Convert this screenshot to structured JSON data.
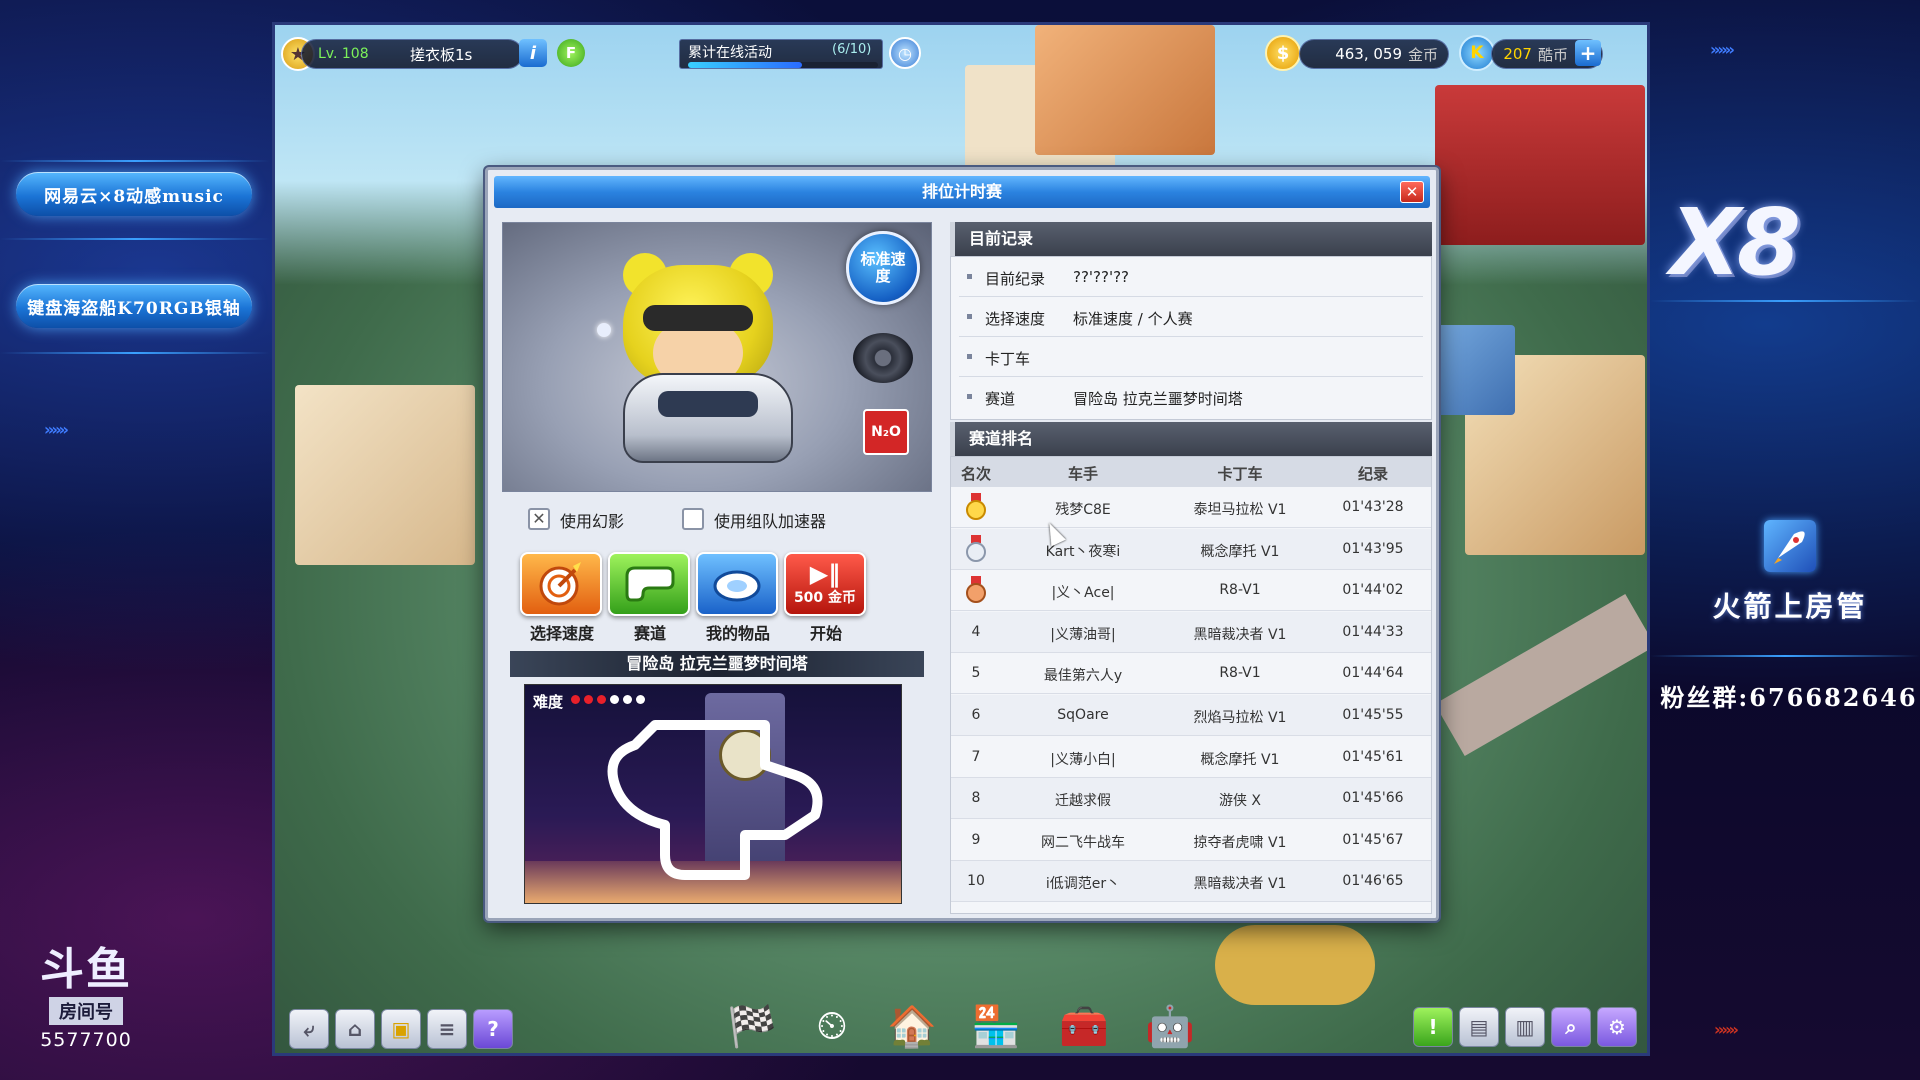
{
  "overlay": {
    "left_pills": [
      "网易云×8动感music",
      "键盘海盗船K70RGB银轴"
    ],
    "douyu_logo": "斗鱼",
    "douyu_room_label": "房间号",
    "douyu_room_number": "5577700",
    "x8_logo": "X8",
    "rocket_text": "火箭上房管",
    "fan_group": "粉丝群:676682646"
  },
  "hud": {
    "level": "Lv. 108",
    "player_name": "搓衣板1s",
    "info_icon_label": "i",
    "f_icon_label": "F",
    "activity_label": "累计在线活动",
    "activity_progress": "(6/10)",
    "activity_fraction": 0.6,
    "gold_amount": "463, 059",
    "gold_unit": "金币",
    "kcoin_amount": "207",
    "kcoin_unit": "酷币",
    "k_icon_label": "K",
    "plus_label": "+"
  },
  "dialog": {
    "title": "排位计时赛",
    "close_label": "✕",
    "speed_badge": "标准速度",
    "n2o_label": "N₂O",
    "options": {
      "use_ghost": "使用幻影",
      "use_team_boost": "使用组队加速器",
      "ghost_checked": true,
      "team_boost_checked": false
    },
    "actions": [
      {
        "label": "选择速度"
      },
      {
        "label": "赛道"
      },
      {
        "label": "我的物品"
      },
      {
        "label": "开始",
        "cost": "500 金币"
      }
    ],
    "track_banner": "冒险岛 拉克兰噩梦时间塔",
    "difficulty_label": "难度",
    "difficulty_level": 3,
    "difficulty_max": 6,
    "current_record": {
      "header": "目前记录",
      "rows": [
        {
          "key": "目前纪录",
          "value": "??'??'??"
        },
        {
          "key": "选择速度",
          "value": "标准速度 / 个人赛"
        },
        {
          "key": "卡丁车",
          "value": ""
        },
        {
          "key": "赛道",
          "value": "冒险岛 拉克兰噩梦时间塔"
        }
      ]
    },
    "ranking": {
      "header": "赛道排名",
      "columns": [
        "名次",
        "车手",
        "卡丁车",
        "纪录"
      ],
      "rows": [
        {
          "rank": "1",
          "driver": "残梦C8E",
          "kart": "泰坦马拉松 V1",
          "time": "01'43'28",
          "medal": "gold"
        },
        {
          "rank": "2",
          "driver": "Kart丶夜寒i",
          "kart": "概念摩托 V1",
          "time": "01'43'95",
          "medal": "silver"
        },
        {
          "rank": "3",
          "driver": "|义丶Ace|",
          "kart": "R8-V1",
          "time": "01'44'02",
          "medal": "bronze"
        },
        {
          "rank": "4",
          "driver": "|义薄油哥|",
          "kart": "黑暗裁决者 V1",
          "time": "01'44'33",
          "medal": ""
        },
        {
          "rank": "5",
          "driver": "最佳第六人y",
          "kart": "R8-V1",
          "time": "01'44'64",
          "medal": ""
        },
        {
          "rank": "6",
          "driver": "SqOare",
          "kart": "烈焰马拉松 V1",
          "time": "01'45'55",
          "medal": ""
        },
        {
          "rank": "7",
          "driver": "|义薄小白|",
          "kart": "概念摩托 V1",
          "time": "01'45'61",
          "medal": ""
        },
        {
          "rank": "8",
          "driver": "迁越求假",
          "kart": "游侠 X",
          "time": "01'45'66",
          "medal": ""
        },
        {
          "rank": "9",
          "driver": "网二飞牛战车",
          "kart": "掠夺者虎啸 V1",
          "time": "01'45'67",
          "medal": ""
        },
        {
          "rank": "10",
          "driver": "i低调范er丶",
          "kart": "黑暗裁决者 V1",
          "time": "01'46'65",
          "medal": ""
        }
      ]
    }
  },
  "bottom_bar": {
    "left_buttons": [
      "back-icon",
      "home-icon",
      "gift-icon",
      "notes-icon",
      "help-icon"
    ],
    "help_label": "?",
    "center_buttons": [
      "race-flag-icon",
      "speedometer-icon",
      "garage-icon",
      "shop-icon",
      "toolbox-icon",
      "robot-icon"
    ],
    "right_buttons": [
      "alert-icon",
      "chat-icon",
      "save-icon",
      "search-icon",
      "settings-icon"
    ],
    "alert_label": "!"
  },
  "colors": {
    "title_blue": "#2b83e0",
    "gold": "#f5b400",
    "section_dark": "#3a404c",
    "difficulty_on": "#e8202a",
    "difficulty_off": "#ffffff"
  }
}
